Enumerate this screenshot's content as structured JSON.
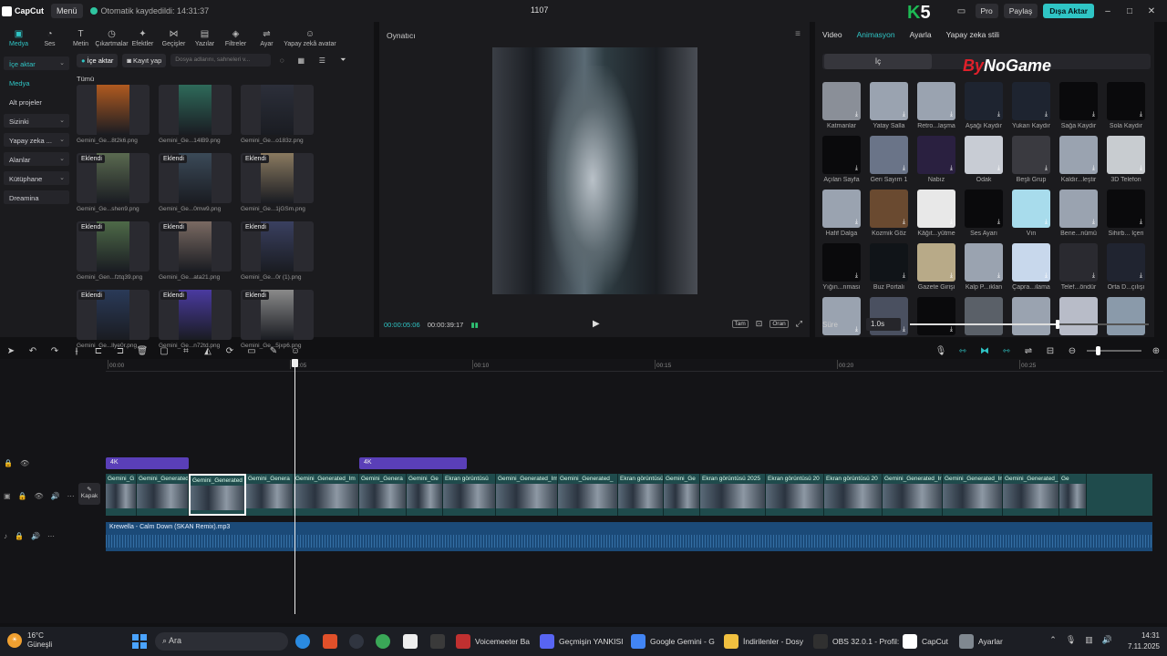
{
  "titlebar": {
    "app": "CapCut",
    "menu": "Menü",
    "autosave": "Otomatik kaydedildi: 14:31:37",
    "project": "1107",
    "pro": "Pro",
    "share": "Paylaş",
    "export": "Dışa Aktar"
  },
  "k5": {
    "k": "K",
    "n": "5"
  },
  "tools": [
    {
      "label": "Medya",
      "icon": "▣"
    },
    {
      "label": "Ses",
      "icon": "◔"
    },
    {
      "label": "Metin",
      "icon": "T"
    },
    {
      "label": "Çıkartmalar",
      "icon": "◷"
    },
    {
      "label": "Efektler",
      "icon": "✦"
    },
    {
      "label": "Geçişler",
      "icon": "⋈"
    },
    {
      "label": "Yazılar",
      "icon": "▤"
    },
    {
      "label": "Filtreler",
      "icon": "◈"
    },
    {
      "label": "Ayar",
      "icon": "⇌"
    },
    {
      "label": "Yapay zekâ avatar",
      "icon": "☺"
    }
  ],
  "sidenav": [
    {
      "label": "İçe aktar"
    },
    {
      "label": "Medya"
    },
    {
      "label": "Alt projeler"
    },
    {
      "label": "Sizinki"
    },
    {
      "label": "Yapay zeka ..."
    },
    {
      "label": "Alanlar"
    },
    {
      "label": "Kütüphane"
    },
    {
      "label": "Dreamina"
    }
  ],
  "media": {
    "import": "İçe aktar",
    "record": "Kayıt yap",
    "search_placeholder": "Dosya adlarını, sahneleri v...",
    "all": "Tümü",
    "badge": "Eklendi",
    "items": [
      {
        "name": "Gemini_Ge...8t2k6.png",
        "color": "#b05a20"
      },
      {
        "name": "Gemini_Ge...14lB9.png",
        "color": "#2e6a5a"
      },
      {
        "name": "Gemini_Ge...o183z.png",
        "color": "#2c2f3a"
      },
      {
        "name": "Gemini_Ge...shen9.png",
        "color": "#5a6a50"
      },
      {
        "name": "Gemini_Ge...0mw9.png",
        "color": "#3b4a58"
      },
      {
        "name": "Gemini_Ge...1jGSm.png",
        "color": "#8a7a60"
      },
      {
        "name": "Gemini_Gen...fztq39.png",
        "color": "#4e6a48"
      },
      {
        "name": "Gemini_Ge...ata21.png",
        "color": "#7a6a62"
      },
      {
        "name": "Gemini_Ge...0r (1).png",
        "color": "#3a4060"
      },
      {
        "name": "Gemini_Ge...llye0r.png",
        "color": "#2a3a58"
      },
      {
        "name": "Gemini_Ge...n72td.png",
        "color": "#4a3aa0"
      },
      {
        "name": "Gemini_Ge...5jxp6.png",
        "color": "#8a8a8a"
      }
    ]
  },
  "player": {
    "title": "Oynatıcı",
    "current": "00:00:05:06",
    "total": "00:00:39:17",
    "btn_full": "Tam",
    "btn_ratio": "Oran"
  },
  "right": {
    "tabs": [
      "Video",
      "Animasyon",
      "Ayarla",
      "Yapay zeka stili"
    ],
    "subtab_in": "İç",
    "watermark_by": "By",
    "watermark_name": "NoGame",
    "duration_label": "Süre",
    "duration_value": "1.0s",
    "slider": 0.62,
    "anims": [
      {
        "label": "Katmanlar",
        "color": "#8a8f98"
      },
      {
        "label": "Yatay Salla",
        "color": "#9aa3b0"
      },
      {
        "label": "Retro...laşma",
        "color": "#9aa3b0"
      },
      {
        "label": "Aşağı Kaydır",
        "color": "#1e2430"
      },
      {
        "label": "Yukarı Kaydır",
        "color": "#1e2430"
      },
      {
        "label": "Sağa Kaydır",
        "color": "#0a0a0c"
      },
      {
        "label": "Sola Kaydır",
        "color": "#0a0a0c"
      },
      {
        "label": "Açılan Sayfa",
        "color": "#0a0a0c"
      },
      {
        "label": "Geri Sayım 1",
        "color": "#6a7488"
      },
      {
        "label": "Nabız",
        "color": "#2a2040"
      },
      {
        "label": "Odak",
        "color": "#c8ccd4"
      },
      {
        "label": "Beşli Grup",
        "color": "#3a3a40"
      },
      {
        "label": "Kaldır...leştir",
        "color": "#9aa3b0"
      },
      {
        "label": "3D Telefon",
        "color": "#c8ccd0"
      },
      {
        "label": "Hafif Dalga",
        "color": "#9aa3b0"
      },
      {
        "label": "Kozmik Göz",
        "color": "#6a4a30"
      },
      {
        "label": "Kâğıt...yütme",
        "color": "#e8e8e8"
      },
      {
        "label": "Ses Ayarı",
        "color": "#0a0a0c"
      },
      {
        "label": "Vın",
        "color": "#a8dcec"
      },
      {
        "label": "Bene...nümü",
        "color": "#9aa3b0"
      },
      {
        "label": "Sihirb... İçeri",
        "color": "#0a0a0c"
      },
      {
        "label": "Yığın...nması",
        "color": "#0a0a0c"
      },
      {
        "label": "Buz Portalı",
        "color": "#101418"
      },
      {
        "label": "Gazete Girişi",
        "color": "#b8aa88"
      },
      {
        "label": "Kalp P...ıklan",
        "color": "#9aa3b0"
      },
      {
        "label": "Çapra...ilama",
        "color": "#c8d8ec"
      },
      {
        "label": "Telef...öndür",
        "color": "#2a2a30"
      },
      {
        "label": "Orta D...çılışı",
        "color": "#202430"
      },
      {
        "label": "",
        "color": "#9aa3b0"
      },
      {
        "label": "",
        "color": "#4a5060"
      },
      {
        "label": "",
        "color": "#0a0a0c"
      },
      {
        "label": "",
        "color": "#5a6068"
      },
      {
        "label": "",
        "color": "#9aa3b0"
      },
      {
        "label": "",
        "color": "#b8bcc8"
      },
      {
        "label": "",
        "color": "#8a9aaa"
      }
    ]
  },
  "timeline": {
    "ticks": [
      "00:00",
      "00:05",
      "00:10",
      "00:15",
      "00:20",
      "00:25"
    ],
    "tag": "4K",
    "kapak": "Kapak",
    "audio": "Krewella - Calm Down (SKAN Remix).mp3",
    "clips": [
      {
        "name": "Gemini_G",
        "w": 34
      },
      {
        "name": "Gemini_Generated",
        "w": 57
      },
      {
        "name": "Gemini_Generated",
        "w": 63,
        "sel": true
      },
      {
        "name": "Gemini_Genera",
        "w": 52
      },
      {
        "name": "Gemini_Generated_Im",
        "w": 72
      },
      {
        "name": "Gemini_Genera",
        "w": 52
      },
      {
        "name": "Gemini_Ge",
        "w": 40
      },
      {
        "name": "Ekran görüntüsü",
        "w": 58
      },
      {
        "name": "Gemini_Generated_Im",
        "w": 68
      },
      {
        "name": "Gemini_Generated_",
        "w": 66
      },
      {
        "name": "Ekran görüntüsü",
        "w": 50
      },
      {
        "name": "Gemini_Ge",
        "w": 40
      },
      {
        "name": "Ekran görüntüsü 2025",
        "w": 72
      },
      {
        "name": "Ekran görüntüsü 20",
        "w": 64
      },
      {
        "name": "Ekran görüntüsü 20",
        "w": 64
      },
      {
        "name": "Gemini_Generated_Ir",
        "w": 66
      },
      {
        "name": "Gemini_Generated_Im",
        "w": 66
      },
      {
        "name": "Gemini_Generated_",
        "w": 62
      },
      {
        "name": "Ge",
        "w": 30
      }
    ]
  },
  "taskbar": {
    "temp": "16°C",
    "weather": "Güneşli",
    "search": "Ara",
    "apps": [
      {
        "label": "Voicemeeter Ba",
        "color": "#c03030"
      },
      {
        "label": "Geçmişin YANKISI",
        "color": "#5865f2"
      },
      {
        "label": "Google Gemini - G",
        "color": "#4285f4"
      },
      {
        "label": "İndirilenler - Dosy",
        "color": "#f0c040"
      },
      {
        "label": "OBS 32.0.1 - Profil:",
        "color": "#303030"
      },
      {
        "label": "CapCut",
        "color": "#ffffff"
      },
      {
        "label": "Ayarlar",
        "color": "#808890"
      }
    ],
    "time": "14:31",
    "date": "7.11.2025"
  }
}
